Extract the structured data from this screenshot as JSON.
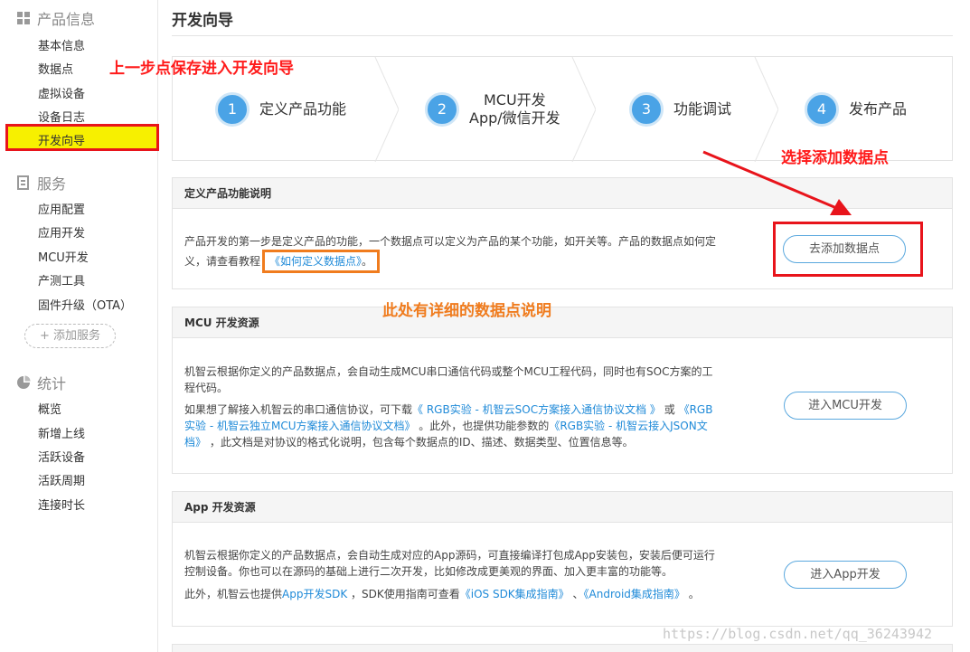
{
  "sidebar": {
    "product_title": "产品信息",
    "product_items": [
      "基本信息",
      "数据点",
      "虚拟设备",
      "设备日志"
    ],
    "active_item": "开发向导",
    "service_title": "服务",
    "service_items": [
      "应用配置",
      "应用开发",
      "MCU开发",
      "产测工具",
      "固件升级（OTA）"
    ],
    "add_service": "+ 添加服务",
    "stats_title": "统计",
    "stats_items": [
      "概览",
      "新增上线",
      "活跃设备",
      "活跃周期",
      "连接时长"
    ]
  },
  "page": {
    "title": "开发向导"
  },
  "steps": [
    {
      "num": "1",
      "line1": "定义产品功能",
      "line2": ""
    },
    {
      "num": "2",
      "line1": "MCU开发",
      "line2": "App/微信开发"
    },
    {
      "num": "3",
      "line1": "功能调试",
      "line2": ""
    },
    {
      "num": "4",
      "line1": "发布产品",
      "line2": ""
    }
  ],
  "define_panel": {
    "title": "定义产品功能说明",
    "line1": "产品开发的第一步是定义产品的功能，一个数据点可以定义为产品的某个功能，如开关等。产品的数据点如何定",
    "line2_prefix": "义，请查看教程",
    "link": "《如何定义数据点》",
    "line2_suffix": "。",
    "button": "去添加数据点"
  },
  "mcu_panel": {
    "title": "MCU 开发资源",
    "p1_line1": "机智云根据你定义的产品数据点，会自动生成MCU串口通信代码或整个MCU工程代码，同时也有SOC方案的工",
    "p1_line2": "程代码。",
    "p2_a": "如果想了解接入机智云的串口通信协议，可下载",
    "p2_link1": "《 RGB实验 - 机智云SOC方案接入通信协议文档 》",
    "p2_or": " 或 ",
    "p2_link2a": "《RGB",
    "p2_link2b": "实验 - 机智云独立MCU方案接入通信协议文档》",
    "p2_b": " 。此外，也提供功能参数的",
    "p2_link3a": "《RGB实验 - 机智云接入JSON文",
    "p2_link3b": "档》",
    "p2_c": " ，此文档是对协议的格式化说明，包含每个数据点的ID、描述、数据类型、位置信息等。",
    "button": "进入MCU开发"
  },
  "app_panel": {
    "title": "App 开发资源",
    "p1_line1": "机智云根据你定义的产品数据点，会自动生成对应的App源码，可直接编译打包成App安装包，安装后便可运行",
    "p1_line2": "控制设备。你也可以在源码的基础上进行二次开发，比如修改成更美观的界面、加入更丰富的功能等。",
    "p2_a": "此外，机智云也提供",
    "p2_link1": "App开发SDK",
    "p2_b": " ，SDK使用指南可查看",
    "p2_link2": "《iOS SDK集成指南》",
    "p2_sep": " 、",
    "p2_link3": "《Android集成指南》",
    "p2_c": " 。",
    "button": "进入App开发"
  },
  "annotations": {
    "top": "上一步点保存进入开发向导",
    "right": "选择添加数据点",
    "middle": "此处有详细的数据点说明",
    "red": "#ff1a1a",
    "orange": "#f07c1e"
  },
  "watermark": "https://blog.csdn.net/qq_36243942"
}
